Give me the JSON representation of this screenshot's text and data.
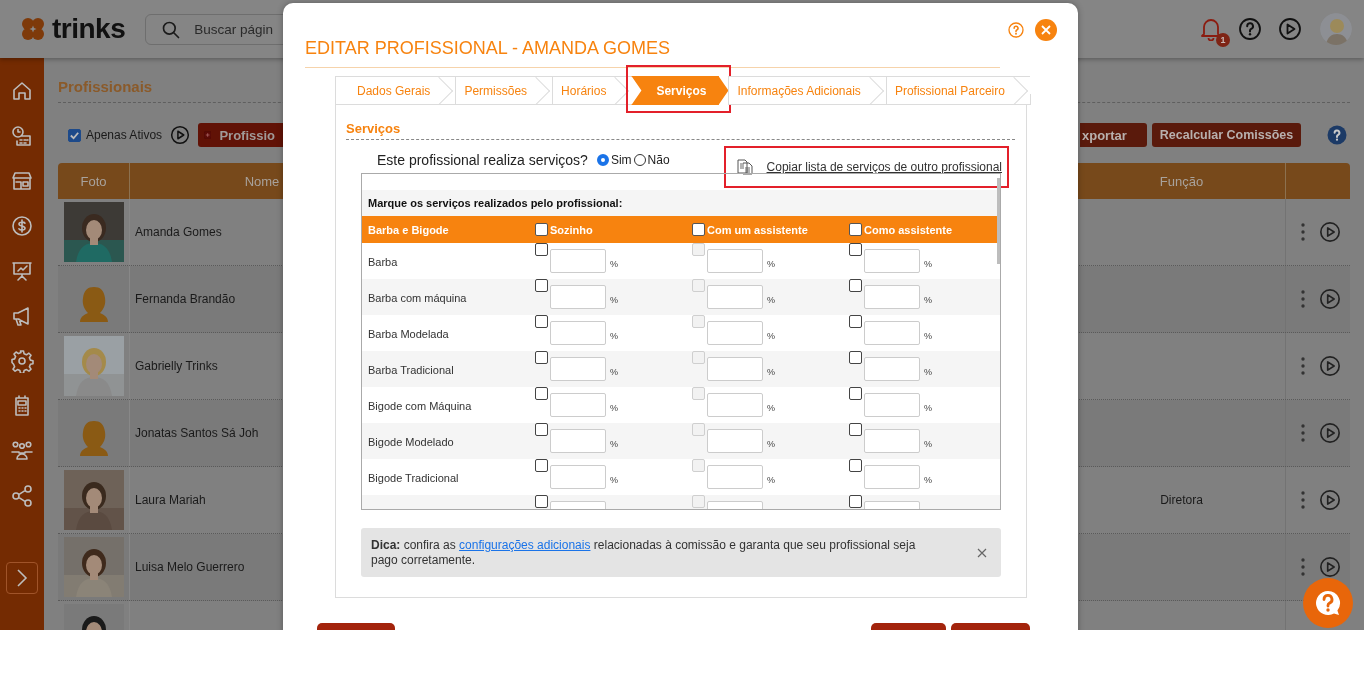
{
  "header": {
    "logo": "trinks",
    "search": {
      "placeholder": "Buscar págin"
    },
    "notifications": {
      "badge": "1"
    }
  },
  "sidebar": {
    "items": [
      {
        "kind": "home"
      },
      {
        "kind": "schedule"
      },
      {
        "kind": "store"
      },
      {
        "kind": "money"
      },
      {
        "kind": "chart"
      },
      {
        "kind": "megaphone"
      },
      {
        "kind": "gear"
      },
      {
        "kind": "calculator"
      },
      {
        "kind": "people"
      },
      {
        "kind": "share"
      }
    ]
  },
  "page": {
    "title": "Profissionais",
    "active_only": {
      "label": "Apenas Ativos",
      "checked": true
    },
    "buttons": [
      {
        "kind": "add",
        "label": "Profissio"
      },
      {
        "kind": "plain",
        "label": "xportar"
      },
      {
        "kind": "plain",
        "label": "Recalcular Comissões"
      }
    ],
    "table": {
      "columns": [
        "Foto",
        "Nome",
        "Função"
      ],
      "rows": [
        {
          "name": "Amanda Gomes",
          "actions": true
        },
        {
          "photo": {
            "kind": "silhouette"
          },
          "name": "Fernanda Brandão",
          "actions": true
        },
        {
          "name": "Gabrielly Trinks",
          "actions": true
        },
        {
          "photo": {
            "kind": "silhouette"
          },
          "name": "Jonatas Santos Sá Joh",
          "actions": true
        },
        {
          "name": "Laura Mariah",
          "role": "Diretora",
          "actions": true
        },
        {
          "name": "Luisa Melo Guerrero",
          "actions": true
        },
        {
          "actions": false
        }
      ]
    }
  },
  "modal": {
    "title": "EDITAR PROFISSIONAL - AMANDA GOMES",
    "tabs": [
      {
        "label": "Dados Gerais",
        "selected": false,
        "highlighted": false
      },
      {
        "label": "Permissões",
        "selected": false,
        "highlighted": false
      },
      {
        "label": "Horários",
        "selected": false,
        "highlighted": false
      },
      {
        "label": "Serviços",
        "selected": true,
        "highlighted": true
      },
      {
        "label": "Informações Adicionais",
        "selected": false,
        "highlighted": false
      },
      {
        "label": "Profissional Parceiro",
        "selected": false,
        "highlighted": false
      }
    ],
    "section_title": "Serviços",
    "question": {
      "label": "Este profissional realiza serviços?",
      "options": [
        {
          "label": "Sim",
          "selected": true
        },
        {
          "label": "Não",
          "selected": false
        }
      ]
    },
    "copy_link": {
      "label": "Copiar lista de serviços de outro profissional",
      "highlighted": true
    },
    "services": {
      "caption": "Marque os serviços realizados pelo profissional:",
      "group": "Barba e Bigode",
      "columns": [
        {
          "label": "Sozinho",
          "checked": false
        },
        {
          "label": "Com um assistente",
          "checked": false
        },
        {
          "label": "Como assistente",
          "checked": false
        }
      ],
      "rows": [
        {
          "name": "Barba",
          "cells": [
            {
              "checked": false,
              "disabled": false,
              "unit": "%"
            },
            {
              "checked": false,
              "disabled": true,
              "unit": "%"
            },
            {
              "checked": false,
              "disabled": false,
              "unit": "%"
            }
          ]
        },
        {
          "name": "Barba com máquina",
          "cells": [
            {
              "checked": false,
              "disabled": false,
              "unit": "%"
            },
            {
              "checked": false,
              "disabled": true,
              "unit": "%"
            },
            {
              "checked": false,
              "disabled": false,
              "unit": "%"
            }
          ]
        },
        {
          "name": "Barba Modelada",
          "cells": [
            {
              "checked": false,
              "disabled": false,
              "unit": "%"
            },
            {
              "checked": false,
              "disabled": true,
              "unit": "%"
            },
            {
              "checked": false,
              "disabled": false,
              "unit": "%"
            }
          ]
        },
        {
          "name": "Barba Tradicional",
          "cells": [
            {
              "checked": false,
              "disabled": false,
              "unit": "%"
            },
            {
              "checked": false,
              "disabled": true,
              "unit": "%"
            },
            {
              "checked": false,
              "disabled": false,
              "unit": "%"
            }
          ]
        },
        {
          "name": "Bigode com Máquina",
          "cells": [
            {
              "checked": false,
              "disabled": false,
              "unit": "%"
            },
            {
              "checked": false,
              "disabled": true,
              "unit": "%"
            },
            {
              "checked": false,
              "disabled": false,
              "unit": "%"
            }
          ]
        },
        {
          "name": "Bigode Modelado",
          "cells": [
            {
              "checked": false,
              "disabled": false,
              "unit": "%"
            },
            {
              "checked": false,
              "disabled": true,
              "unit": "%"
            },
            {
              "checked": false,
              "disabled": false,
              "unit": "%"
            }
          ]
        },
        {
          "name": "Bigode Tradicional",
          "cells": [
            {
              "checked": false,
              "disabled": false,
              "unit": "%"
            },
            {
              "checked": false,
              "disabled": true,
              "unit": "%"
            },
            {
              "checked": false,
              "disabled": false,
              "unit": "%"
            }
          ]
        },
        {
          "cells": [
            {
              "checked": false,
              "disabled": false
            },
            {
              "checked": false,
              "disabled": true
            },
            {
              "checked": false,
              "disabled": false
            }
          ]
        }
      ]
    },
    "tip": {
      "lead": "**Dica:** confira as ",
      "link": "configurações adicionais",
      "rest": " relacionadas à comissão e garanta que seu profissional seja pago corretamente."
    },
    "footer_buttons": {
      "left": [
        {
          "kind": "button"
        }
      ],
      "right": [
        {
          "kind": "button"
        },
        {
          "kind": "button"
        }
      ]
    }
  }
}
